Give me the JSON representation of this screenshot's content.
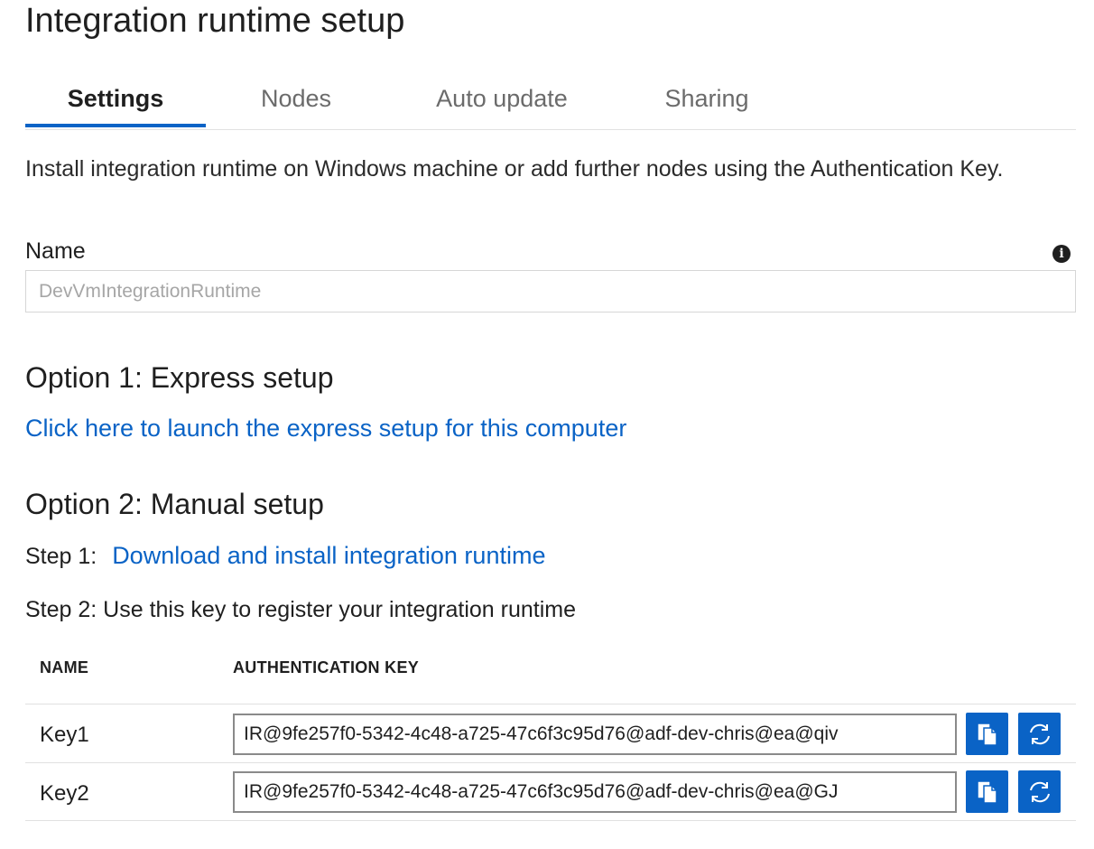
{
  "page": {
    "title": "Integration runtime setup"
  },
  "tabs": [
    {
      "label": "Settings",
      "active": true
    },
    {
      "label": "Nodes",
      "active": false
    },
    {
      "label": "Auto update",
      "active": false
    },
    {
      "label": "Sharing",
      "active": false
    }
  ],
  "description": "Install integration runtime on Windows machine or add further nodes using the Authentication Key.",
  "name_field": {
    "label": "Name",
    "value": "DevVmIntegrationRuntime",
    "info_icon": "info-icon"
  },
  "option1": {
    "heading": "Option 1: Express setup",
    "link": "Click here to launch the express setup for this computer"
  },
  "option2": {
    "heading": "Option 2: Manual setup",
    "step1_prefix": "Step 1:",
    "step1_link": "Download and install integration runtime",
    "step2": "Step 2: Use this key to register your integration runtime"
  },
  "keys_table": {
    "columns": [
      "NAME",
      "AUTHENTICATION KEY"
    ],
    "rows": [
      {
        "name": "Key1",
        "key": "IR@9fe257f0-5342-4c48-a725-47c6f3c95d76@adf-dev-chris@ea@qiv"
      },
      {
        "name": "Key2",
        "key": "IR@9fe257f0-5342-4c48-a725-47c6f3c95d76@adf-dev-chris@ea@GJ"
      }
    ],
    "copy_icon": "copy-icon",
    "refresh_icon": "refresh-icon"
  },
  "colors": {
    "accent": "#0a63c6",
    "text": "#1f1f1f",
    "muted": "#6b6b6b",
    "border": "#e1e1e1"
  }
}
